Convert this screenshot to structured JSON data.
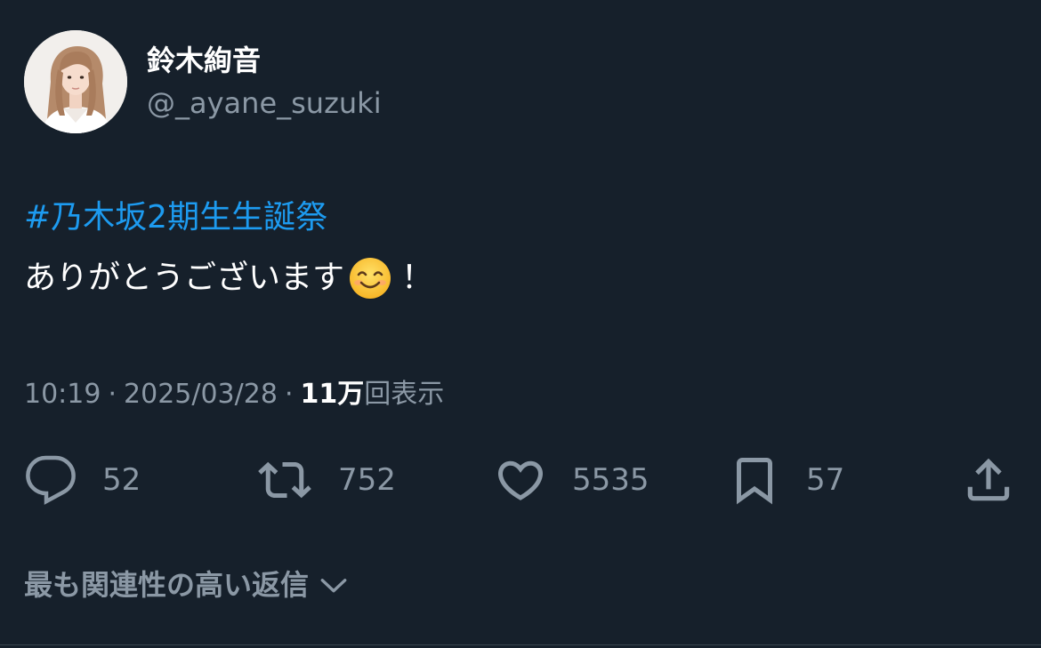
{
  "user": {
    "display_name": "鈴木絢音",
    "handle": "@_ayane_suzuki"
  },
  "tweet": {
    "hashtag": "#乃木坂2期生生誕祭",
    "text": "ありがとうございます",
    "emoji": "smiling-face-with-smiling-eyes-icon",
    "text_suffix": "！"
  },
  "meta": {
    "time": "10:19",
    "date": "2025/03/28",
    "views_count": "11万",
    "views_label": "回表示",
    "separator": "·"
  },
  "actions": {
    "reply_count": "52",
    "retweet_count": "752",
    "like_count": "5535",
    "bookmark_count": "57"
  },
  "replies_sort": {
    "label": "最も関連性の高い返信"
  },
  "colors": {
    "background": "#16202b",
    "accent": "#1d9bf0",
    "secondary_text": "#8b98a5"
  }
}
